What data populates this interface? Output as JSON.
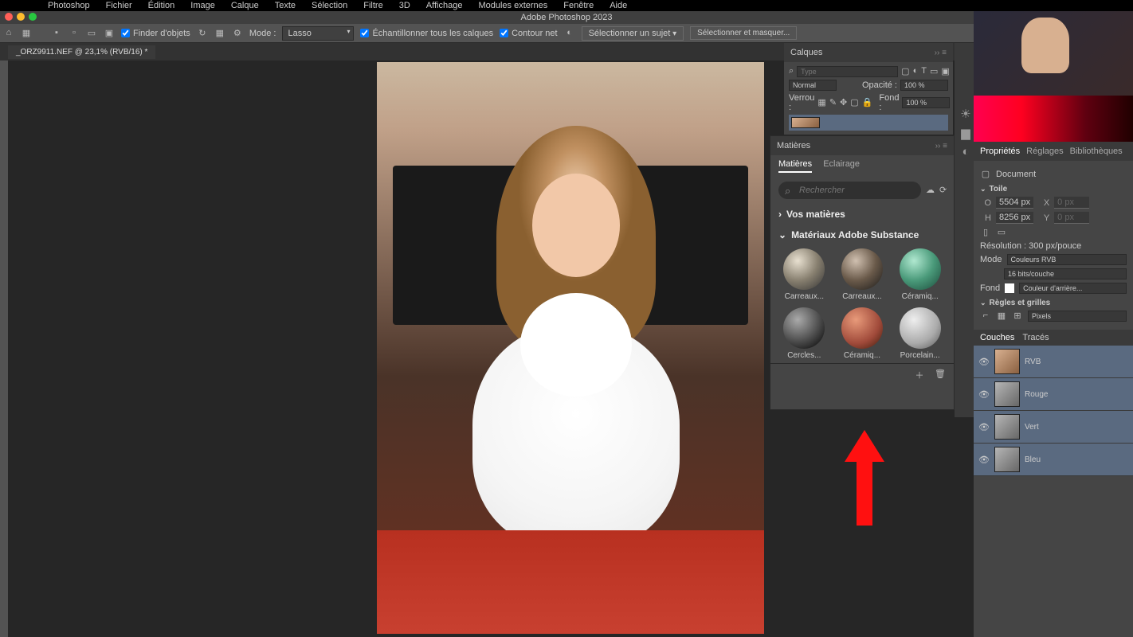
{
  "app_title": "Adobe Photoshop 2023",
  "menubar": [
    "Photoshop",
    "Fichier",
    "Édition",
    "Image",
    "Calque",
    "Texte",
    "Sélection",
    "Filtre",
    "3D",
    "Affichage",
    "Modules externes",
    "Fenêtre",
    "Aide"
  ],
  "document_tab": "_ORZ9911.NEF @ 23,1% (RVB/16) *",
  "options": {
    "find_objects": "Finder d'objets",
    "mode_label": "Mode :",
    "mode_value": "Lasso",
    "sample_all": "Échantillonner tous les calques",
    "contour": "Contour net",
    "select_subject": "Sélectionner un sujet",
    "select_mask": "Sélectionner et masquer..."
  },
  "layers_panel": {
    "title": "Calques",
    "filter_placeholder": "Type",
    "blend_mode": "Normal",
    "opacity_label": "Opacité :",
    "opacity_value": "100 %",
    "lock_label": "Verrou :",
    "fill_label": "Fond :",
    "fill_value": "100 %"
  },
  "materials_panel": {
    "title": "Matières",
    "tab_materials": "Matières",
    "tab_lighting": "Eclairage",
    "search_placeholder": "Rechercher",
    "section_your": "Vos matières",
    "section_adobe": "Matériaux Adobe Substance",
    "items": [
      {
        "label": "Carreaux..."
      },
      {
        "label": "Carreaux..."
      },
      {
        "label": "Céramiq..."
      },
      {
        "label": "Cercles..."
      },
      {
        "label": "Céramiq..."
      },
      {
        "label": "Porcelain..."
      }
    ]
  },
  "properties_panel": {
    "tab_props": "Propriétés",
    "tab_adjust": "Réglages",
    "tab_libs": "Bibliothèques",
    "doc_label": "Document",
    "canvas_section": "Toile",
    "w_label": "O",
    "w_value": "5504 px",
    "x_label": "X",
    "x_value": "0 px",
    "h_label": "H",
    "h_value": "8256 px",
    "y_label": "Y",
    "y_value": "0 px",
    "resolution": "Résolution : 300 px/pouce",
    "mode_label": "Mode",
    "mode_value": "Couleurs RVB",
    "depth_value": "16 bits/couche",
    "bg_label": "Fond",
    "bg_value": "Couleur d'arrière...",
    "rulers_section": "Règles et grilles",
    "ruler_unit": "Pixels"
  },
  "channels_panel": {
    "tab_channels": "Couches",
    "tab_paths": "Tracés",
    "rows": [
      {
        "label": "RVB"
      },
      {
        "label": "Rouge"
      },
      {
        "label": "Vert"
      },
      {
        "label": "Bleu"
      }
    ]
  }
}
